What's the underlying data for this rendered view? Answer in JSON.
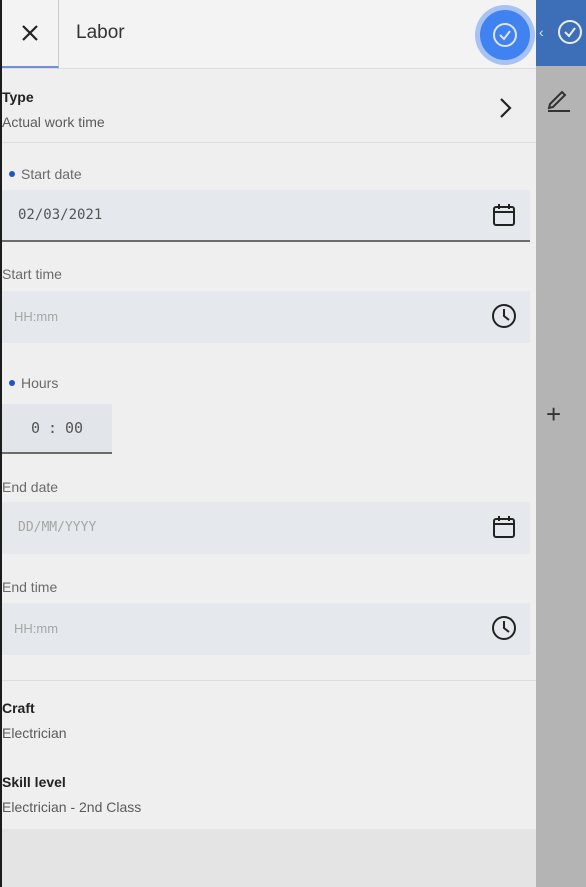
{
  "header": {
    "title": "Labor"
  },
  "type_row": {
    "label": "Type",
    "value": "Actual work time"
  },
  "start_date": {
    "label": "Start date",
    "value": "02/03/2021"
  },
  "start_time": {
    "label": "Start time",
    "placeholder": "HH:mm"
  },
  "hours": {
    "label": "Hours",
    "hours": "0",
    "separator": ":",
    "minutes": "00"
  },
  "end_date": {
    "label": "End date",
    "placeholder": "DD/MM/YYYY"
  },
  "end_time": {
    "label": "End time",
    "placeholder": "HH:mm"
  },
  "craft": {
    "label": "Craft",
    "value": "Electrician"
  },
  "skill_level": {
    "label": "Skill level",
    "value": "Electrician - 2nd Class"
  },
  "colors": {
    "accent": "#3f82f0",
    "required_dot": "#1f55c8",
    "input_bg": "#e5e8ec"
  },
  "icons": [
    "close-icon",
    "checkmark-icon",
    "chevron-right-icon",
    "calendar-icon",
    "clock-icon",
    "pencil-icon",
    "plus-icon"
  ]
}
